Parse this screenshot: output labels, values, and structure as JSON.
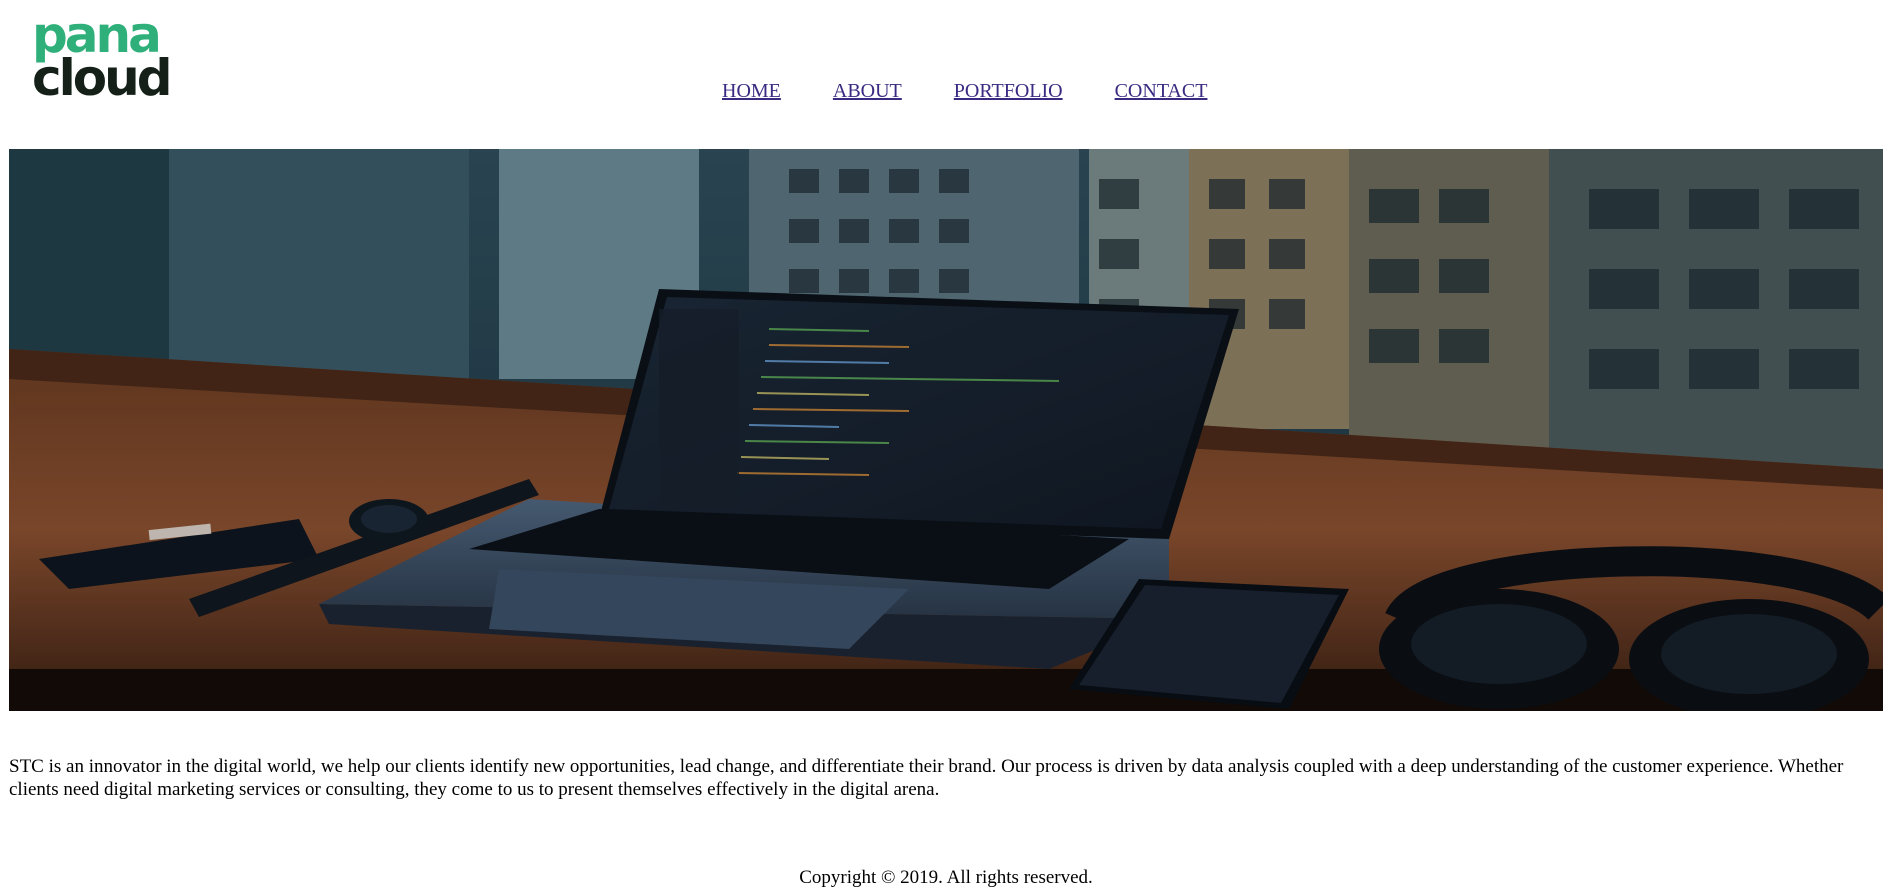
{
  "logo": {
    "line1": "pana",
    "line2": "cloud",
    "colors": {
      "green": "#2fb07a",
      "dark": "#142018"
    }
  },
  "nav": {
    "items": [
      {
        "label": "HOME"
      },
      {
        "label": "ABOUT"
      },
      {
        "label": "PORTFOLIO"
      },
      {
        "label": "CONTACT"
      }
    ],
    "link_color": "#3b2a82"
  },
  "hero": {
    "description": "laptop-desk-photo"
  },
  "intro": {
    "text": "STC is an innovator in the digital world, we help our clients identify new opportunities, lead change, and differentiate their brand. Our process is driven by data analysis coupled with a deep understanding of the customer experience. Whether clients need digital marketing services or consulting, they come to us to present themselves effectively in the digital arena."
  },
  "footer": {
    "copyright": "Copyright © 2019. All rights reserved."
  }
}
